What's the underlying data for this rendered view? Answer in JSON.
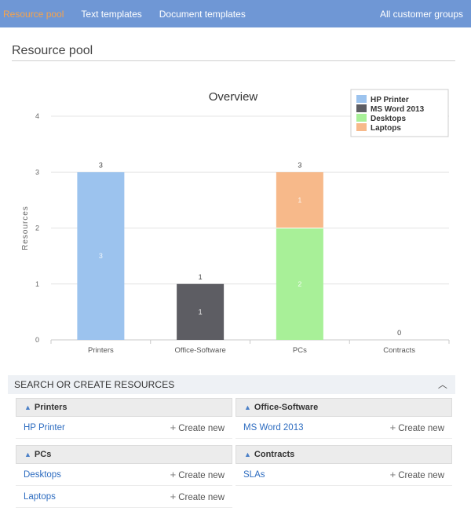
{
  "nav": {
    "items": [
      {
        "label": "Resource pool",
        "active": true
      },
      {
        "label": "Text templates",
        "active": false
      },
      {
        "label": "Document templates",
        "active": false
      }
    ],
    "right": "All customer groups"
  },
  "page": {
    "title": "Resource pool"
  },
  "chart_data": {
    "type": "bar",
    "stacked": true,
    "title": "Overview",
    "xlabel": "",
    "ylabel": "Resources",
    "ylim": [
      0,
      4
    ],
    "yticks": [
      0,
      1,
      2,
      3,
      4
    ],
    "categories": [
      "Printers",
      "Office-Software",
      "PCs",
      "Contracts"
    ],
    "totals": [
      3,
      1,
      3,
      0
    ],
    "series": [
      {
        "name": "HP Printer",
        "color": "#9cc3ee",
        "values": [
          3,
          0,
          0,
          0
        ]
      },
      {
        "name": "MS Word 2013",
        "color": "#5d5d63",
        "values": [
          0,
          1,
          0,
          0
        ]
      },
      {
        "name": "Desktops",
        "color": "#a8f098",
        "values": [
          0,
          0,
          2,
          0
        ]
      },
      {
        "name": "Laptops",
        "color": "#f7b98a",
        "values": [
          0,
          0,
          1,
          0
        ]
      }
    ],
    "grid": true,
    "legend": "top-right"
  },
  "search": {
    "header": "SEARCH OR CREATE RESOURCES",
    "groups": [
      {
        "title": "Printers",
        "items": [
          {
            "label": "HP Printer",
            "action": "Create new"
          }
        ]
      },
      {
        "title": "Office-Software",
        "items": [
          {
            "label": "MS Word 2013",
            "action": "Create new"
          }
        ]
      },
      {
        "title": "PCs",
        "items": [
          {
            "label": "Desktops",
            "action": "Create new"
          },
          {
            "label": "Laptops",
            "action": "Create new"
          }
        ]
      },
      {
        "title": "Contracts",
        "items": [
          {
            "label": "SLAs",
            "action": "Create new"
          }
        ]
      }
    ]
  },
  "colors": {
    "nav_bg": "#6f97d5",
    "nav_active": "#f7a34a",
    "link": "#2d6cc0"
  }
}
